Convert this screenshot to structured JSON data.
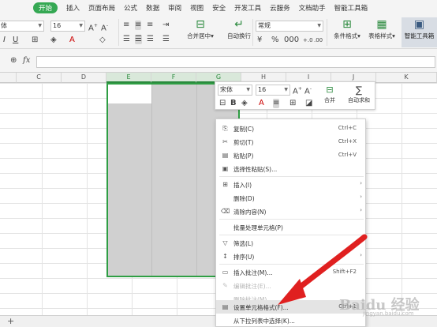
{
  "ribbon_tabs": [
    "开始",
    "插入",
    "页面布局",
    "公式",
    "数据",
    "审阅",
    "视图",
    "安全",
    "开发工具",
    "云服务",
    "文档助手",
    "智能工具箱"
  ],
  "ribbon": {
    "font_name": "体",
    "font_size": "16",
    "number_format": "常规",
    "merge_center": "合并居中",
    "wrap_text": "自动换行",
    "cond_format": "条件格式",
    "table_style": "表格样式",
    "smart_toolbox": "智能工具箱"
  },
  "formula_bar": {
    "fx": "fx",
    "value": ""
  },
  "columns": [
    "C",
    "D",
    "E",
    "F",
    "G",
    "H",
    "I",
    "J",
    "K"
  ],
  "selected_columns": [
    "E",
    "F",
    "G"
  ],
  "mini_toolbar": {
    "font_name": "宋体",
    "font_size": "16",
    "bold": "B",
    "merge_label": "合并",
    "autosum_label": "自动求和"
  },
  "context_menu": [
    {
      "icon": "copy-icon",
      "glyph": "⎘",
      "label": "复制(C)",
      "shortcut": "Ctrl+C",
      "enabled": true
    },
    {
      "icon": "cut-icon",
      "glyph": "✂",
      "label": "剪切(T)",
      "shortcut": "Ctrl+X",
      "enabled": true
    },
    {
      "icon": "paste-icon",
      "glyph": "📋",
      "label": "粘贴(P)",
      "shortcut": "Ctrl+V",
      "enabled": true
    },
    {
      "icon": "paste-special-icon",
      "glyph": "▣",
      "label": "选择性粘贴(S)...",
      "shortcut": "",
      "enabled": true
    },
    {
      "icon": "insert-icon",
      "glyph": "⊞",
      "label": "插入(I)",
      "shortcut": "",
      "enabled": true,
      "submenu": true
    },
    {
      "icon": "",
      "glyph": "",
      "label": "删除(D)",
      "shortcut": "",
      "enabled": true,
      "submenu": true
    },
    {
      "icon": "clear-icon",
      "glyph": "⌫",
      "label": "清除内容(N)",
      "shortcut": "",
      "enabled": true,
      "submenu": true
    },
    {
      "icon": "",
      "glyph": "",
      "label": "批量处理单元格(P)",
      "shortcut": "",
      "enabled": true
    },
    {
      "icon": "filter-icon",
      "glyph": "▽",
      "label": "筛选(L)",
      "shortcut": "",
      "enabled": true,
      "submenu": true
    },
    {
      "icon": "sort-icon",
      "glyph": "↕",
      "label": "排序(U)",
      "shortcut": "",
      "enabled": true,
      "submenu": true
    },
    {
      "icon": "comment-icon",
      "glyph": "▭",
      "label": "插入批注(M)...",
      "shortcut": "Shift+F2",
      "enabled": true
    },
    {
      "icon": "edit-comment-icon",
      "glyph": "✎",
      "label": "编辑批注(E)...",
      "shortcut": "",
      "enabled": false
    },
    {
      "icon": "",
      "glyph": "",
      "label": "删除批注(M)",
      "shortcut": "",
      "enabled": false
    },
    {
      "icon": "format-cells-icon",
      "glyph": "▤",
      "label": "设置单元格格式(F)...",
      "shortcut": "Ctrl+1",
      "enabled": true,
      "highlighted": true
    },
    {
      "icon": "",
      "glyph": "",
      "label": "从下拉列表中选择(K)...",
      "shortcut": "",
      "enabled": true
    }
  ],
  "watermark": {
    "text": "Baidu 经验",
    "sub": "jingyan.baidu.com"
  },
  "colors": {
    "accent": "#35a853",
    "selection_border": "#2f9e44",
    "arrow": "#e02020"
  }
}
